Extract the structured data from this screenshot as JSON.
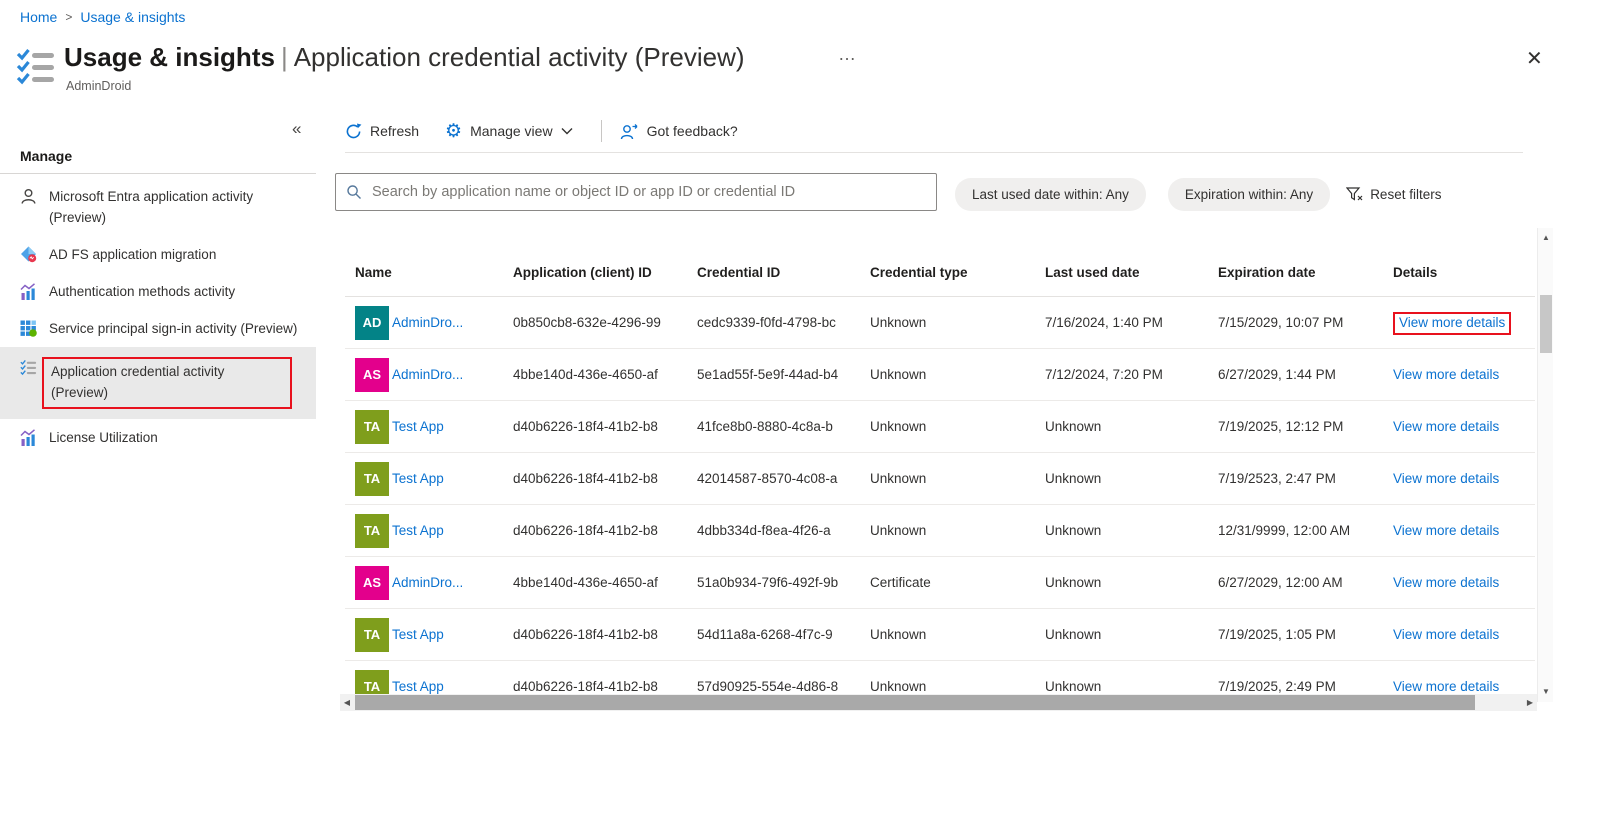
{
  "breadcrumb": {
    "items": [
      "Home",
      "Usage & insights"
    ],
    "separator": ">"
  },
  "header": {
    "title_bold": "Usage & insights",
    "title_separator": "|",
    "title_rest": "Application credential activity (Preview)",
    "subtitle": "AdminDroid",
    "ellipsis": "…",
    "close": "✕"
  },
  "sidebar": {
    "section_title": "Manage",
    "items": [
      {
        "label": "Microsoft Entra application activity (Preview)",
        "icon": "person-icon",
        "selected": false
      },
      {
        "label": "AD FS application migration",
        "icon": "adfs-migration-icon",
        "selected": false
      },
      {
        "label": "Authentication methods activity",
        "icon": "bar-chart-icon",
        "selected": false
      },
      {
        "label": "Service principal sign-in activity (Preview)",
        "icon": "grid-apps-icon",
        "selected": false
      },
      {
        "label": "Application credential activity (Preview)",
        "icon": "checklist-icon",
        "selected": true,
        "annotated": true
      },
      {
        "label": "License Utilization",
        "icon": "bar-chart-icon",
        "selected": false
      }
    ]
  },
  "toolbar": {
    "collapse": "«",
    "refresh_label": "Refresh",
    "manage_view_label": "Manage view",
    "gear_glyph": "⚙",
    "feedback_label": "Got feedback?"
  },
  "filters": {
    "search_placeholder": "Search by application name or object ID or app ID or credential ID",
    "search_value": "",
    "pills": [
      "Last used date within: Any",
      "Expiration within: Any"
    ],
    "reset_label": "Reset filters"
  },
  "table": {
    "columns": [
      "Name",
      "Application (client) ID",
      "Credential ID",
      "Credential type",
      "Last used date",
      "Expiration date",
      "Details"
    ],
    "rows": [
      {
        "initials": "AD",
        "avatar_color": "#038387",
        "name": "AdminDro...",
        "app_id": "0b850cb8-632e-4296-99",
        "cred_id": "cedc9339-f0fd-4798-bc",
        "cred_type": "Unknown",
        "last_used": "7/16/2024, 1:40 PM",
        "expiration": "7/15/2029, 10:07 PM",
        "details": "View more details",
        "annotated": true
      },
      {
        "initials": "AS",
        "avatar_color": "#e3008c",
        "name": "AdminDro...",
        "app_id": "4bbe140d-436e-4650-af",
        "cred_id": "5e1ad55f-5e9f-44ad-b4",
        "cred_type": "Unknown",
        "last_used": "7/12/2024, 7:20 PM",
        "expiration": "6/27/2029, 1:44 PM",
        "details": "View more details",
        "annotated": false
      },
      {
        "initials": "TA",
        "avatar_color": "#7f9e1c",
        "name": "Test App",
        "app_id": "d40b6226-18f4-41b2-b8",
        "cred_id": "41fce8b0-8880-4c8a-b",
        "cred_type": "Unknown",
        "last_used": "Unknown",
        "expiration": "7/19/2025, 12:12 PM",
        "details": "View more details",
        "annotated": false
      },
      {
        "initials": "TA",
        "avatar_color": "#7f9e1c",
        "name": "Test App",
        "app_id": "d40b6226-18f4-41b2-b8",
        "cred_id": "42014587-8570-4c08-a",
        "cred_type": "Unknown",
        "last_used": "Unknown",
        "expiration": "7/19/2523, 2:47 PM",
        "details": "View more details",
        "annotated": false
      },
      {
        "initials": "TA",
        "avatar_color": "#7f9e1c",
        "name": "Test App",
        "app_id": "d40b6226-18f4-41b2-b8",
        "cred_id": "4dbb334d-f8ea-4f26-a",
        "cred_type": "Unknown",
        "last_used": "Unknown",
        "expiration": "12/31/9999, 12:00 AM",
        "details": "View more details",
        "annotated": false
      },
      {
        "initials": "AS",
        "avatar_color": "#e3008c",
        "name": "AdminDro...",
        "app_id": "4bbe140d-436e-4650-af",
        "cred_id": "51a0b934-79f6-492f-9b",
        "cred_type": "Certificate",
        "last_used": "Unknown",
        "expiration": "6/27/2029, 12:00 AM",
        "details": "View more details",
        "annotated": false
      },
      {
        "initials": "TA",
        "avatar_color": "#7f9e1c",
        "name": "Test App",
        "app_id": "d40b6226-18f4-41b2-b8",
        "cred_id": "54d11a8a-6268-4f7c-9",
        "cred_type": "Unknown",
        "last_used": "Unknown",
        "expiration": "7/19/2025, 1:05 PM",
        "details": "View more details",
        "annotated": false
      },
      {
        "initials": "TA",
        "avatar_color": "#7f9e1c",
        "name": "Test App",
        "app_id": "d40b6226-18f4-41b2-b8",
        "cred_id": "57d90925-554e-4d86-8",
        "cred_type": "Unknown",
        "last_used": "Unknown",
        "expiration": "7/19/2025, 2:49 PM",
        "details": "View more details",
        "annotated": false
      }
    ]
  },
  "scrollbars": {
    "up": "▲",
    "down": "▼",
    "left": "◀",
    "right": "▶"
  },
  "colors": {
    "link_blue": "#0b72d0",
    "accent_blue": "#0078d4",
    "text_dark": "#323130",
    "text_gray": "#605e5c",
    "annotation_red": "#e8111d",
    "avatar_teal": "#038387",
    "avatar_magenta": "#e3008c",
    "avatar_olive": "#7f9e1c",
    "selected_bg": "#e9e9e9"
  }
}
